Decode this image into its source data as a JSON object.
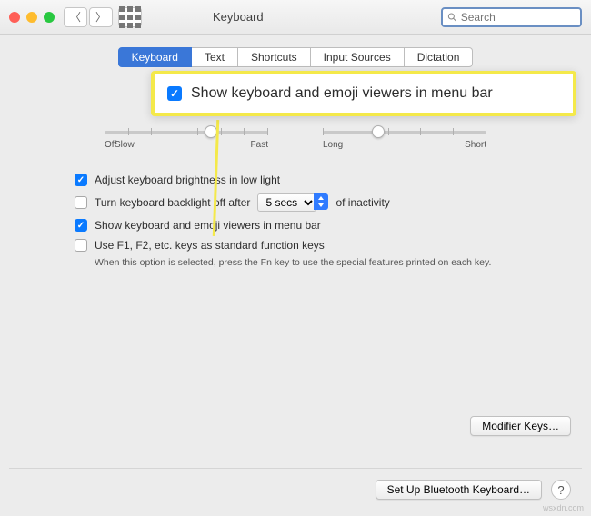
{
  "window": {
    "title": "Keyboard"
  },
  "search": {
    "placeholder": "Search"
  },
  "tabs": [
    "Keyboard",
    "Text",
    "Shortcuts",
    "Input Sources",
    "Dictation"
  ],
  "callout": {
    "label": "Show keyboard and emoji viewers in menu bar"
  },
  "sliders": {
    "repeat": {
      "left": "Off",
      "mid": "Slow",
      "right": "Fast"
    },
    "delay": {
      "left": "Long",
      "right": "Short"
    }
  },
  "options": {
    "brightness": "Adjust keyboard brightness in low light",
    "backlight_pre": "Turn keyboard backlight off after",
    "backlight_val": "5 secs",
    "backlight_post": "of inactivity",
    "emojiviewer": "Show keyboard and emoji viewers in menu bar",
    "fnkeys": "Use F1, F2, etc. keys as standard function keys",
    "fnhelp": "When this option is selected, press the Fn key to use the special features printed on each key."
  },
  "buttons": {
    "modifier": "Modifier Keys…",
    "bluetooth": "Set Up Bluetooth Keyboard…"
  },
  "watermark": "wsxdn.com"
}
